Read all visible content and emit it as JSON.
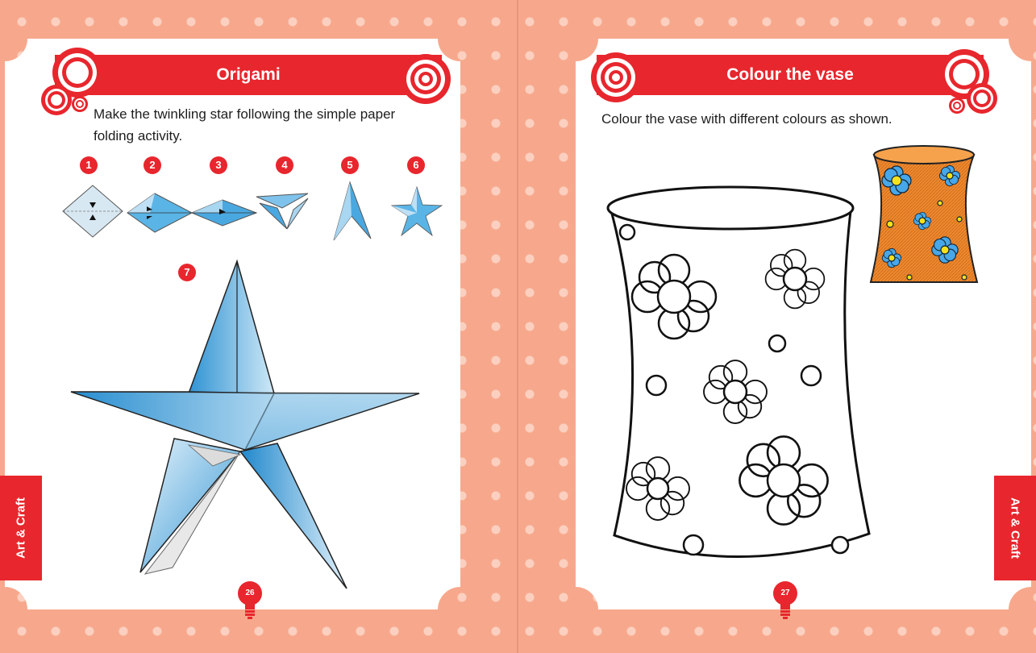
{
  "colors": {
    "background": "#f7a88c",
    "dots": "#fbd0c0",
    "accent_red": "#e8262d",
    "page": "#ffffff",
    "star_blue": "#3aa2dc",
    "vase_orange": "#f0892e"
  },
  "left_page": {
    "title": "Origami",
    "instruction": "Make the twinkling star following the simple paper folding activity.",
    "steps": [
      "1",
      "2",
      "3",
      "4",
      "5",
      "6",
      "7"
    ],
    "page_number": "26"
  },
  "right_page": {
    "title": "Colour the vase",
    "instruction": "Colour the vase with different colours as shown.",
    "page_number": "27"
  },
  "side_tabs": {
    "left": "Art & Craft",
    "right": "Art & Craft"
  },
  "icons": [
    "target-icon",
    "lightbulb-icon",
    "origami-star",
    "vase-outline",
    "vase-coloured"
  ]
}
